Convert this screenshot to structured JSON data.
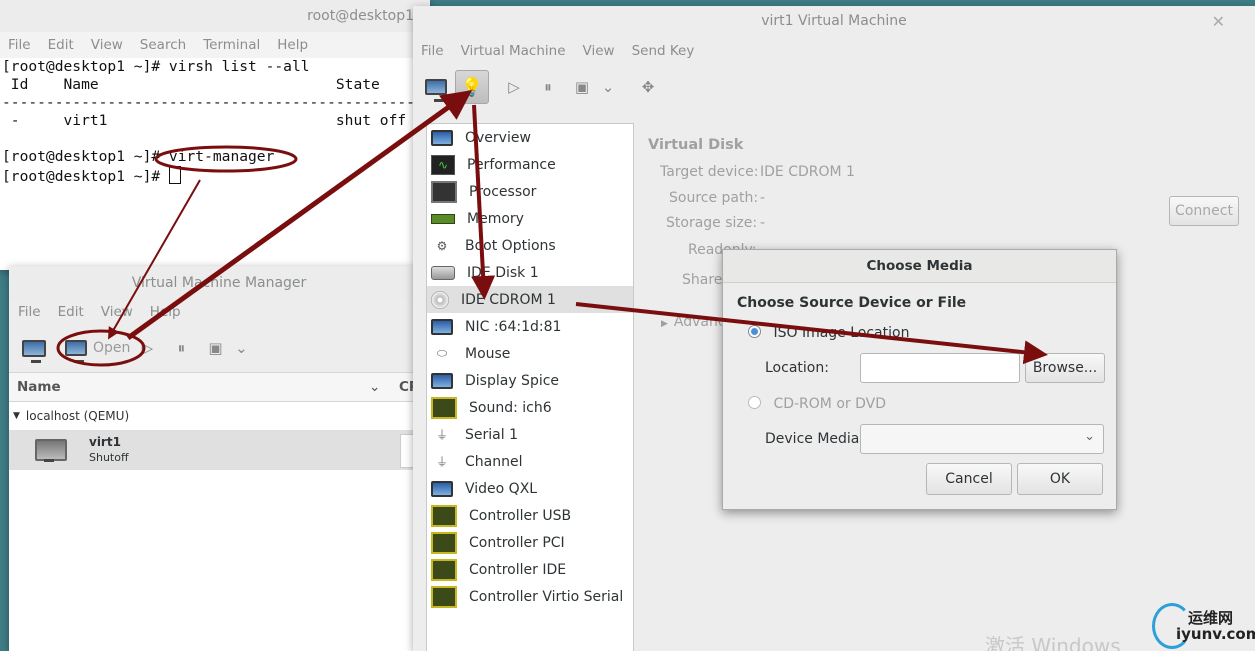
{
  "terminal": {
    "title": "root@desktop1",
    "menu": [
      "File",
      "Edit",
      "View",
      "Search",
      "Terminal",
      "Help"
    ],
    "lines": [
      "[root@desktop1 ~]# virsh list --all",
      " Id    Name                           State",
      "----------------------------------------------------",
      " -     virt1                          shut off",
      "",
      "[root@desktop1 ~]# virt-manager",
      "[root@desktop1 ~]# "
    ]
  },
  "vmm": {
    "title": "Virtual Machine Manager",
    "menu": [
      "File",
      "Edit",
      "View",
      "Help"
    ],
    "open_label": "Open",
    "col_name": "Name",
    "col_cpu": "CPU",
    "connection": "localhost (QEMU)",
    "vm_name": "virt1",
    "vm_state": "Shutoff"
  },
  "vmdetail": {
    "title": "virt1 Virtual Machine",
    "menu": [
      "File",
      "Virtual Machine",
      "View",
      "Send Key"
    ],
    "hardware": [
      {
        "label": "Overview",
        "icon": "monitor-icon"
      },
      {
        "label": "Performance",
        "icon": "performance-icon"
      },
      {
        "label": "Processor",
        "icon": "cpu-icon"
      },
      {
        "label": "Memory",
        "icon": "memory-icon"
      },
      {
        "label": "Boot Options",
        "icon": "gear-icon"
      },
      {
        "label": "IDE Disk 1",
        "icon": "disk-icon"
      },
      {
        "label": "IDE CDROM 1",
        "icon": "cdrom-icon"
      },
      {
        "label": "NIC :64:1d:81",
        "icon": "network-icon"
      },
      {
        "label": "Mouse",
        "icon": "mouse-icon"
      },
      {
        "label": "Display Spice",
        "icon": "display-icon"
      },
      {
        "label": "Sound: ich6",
        "icon": "sound-icon"
      },
      {
        "label": "Serial 1",
        "icon": "serial-icon"
      },
      {
        "label": "Channel",
        "icon": "channel-icon"
      },
      {
        "label": "Video QXL",
        "icon": "video-icon"
      },
      {
        "label": "Controller USB",
        "icon": "controller-icon"
      },
      {
        "label": "Controller PCI",
        "icon": "controller-icon"
      },
      {
        "label": "Controller IDE",
        "icon": "controller-icon"
      },
      {
        "label": "Controller Virtio Serial",
        "icon": "controller-icon"
      }
    ],
    "selected_index": 6,
    "section_title": "Virtual Disk",
    "target_device_label": "Target device:",
    "target_device_value": "IDE CDROM 1",
    "source_path_label": "Source path:",
    "source_path_value": "-",
    "storage_size_label": "Storage size:",
    "storage_size_value": "-",
    "readonly_label": "Readonly:",
    "shareable_label": "Shareable:",
    "advanced_label": "Advanced options",
    "connect_label": "Connect"
  },
  "dialog": {
    "title": "Choose Media",
    "heading": "Choose Source Device or File",
    "iso_label": "ISO Image Location",
    "location_label": "Location:",
    "location_value": "",
    "browse_label": "Browse...",
    "cdrom_label": "CD-ROM or DVD",
    "device_media_label": "Device Media:",
    "device_media_value": "",
    "cancel_label": "Cancel",
    "ok_label": "OK"
  },
  "watermark": {
    "activate": "激活 Windows",
    "site_cn": "运维网",
    "site_url": "iyunv.com"
  },
  "colors": {
    "annotation": "#7a0e0e",
    "selection": "#e0e0e0",
    "accent": "#4a90d9"
  }
}
